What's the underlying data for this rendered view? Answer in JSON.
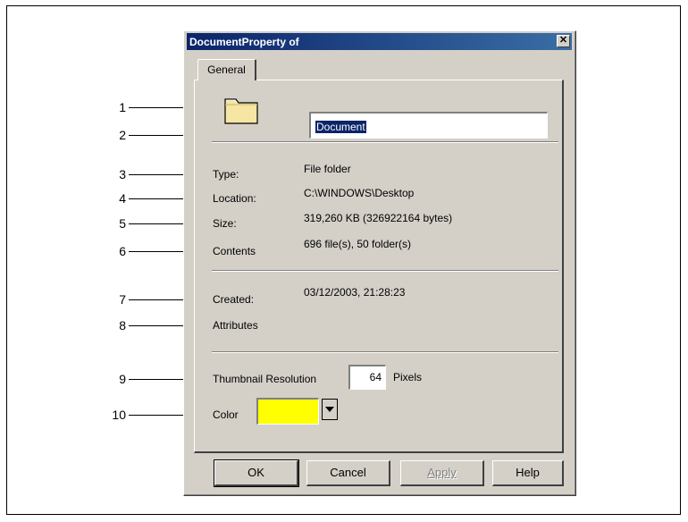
{
  "dialog": {
    "title": "DocumentProperty of",
    "close_symbol": "✕"
  },
  "tabs": [
    {
      "label": "General"
    }
  ],
  "general": {
    "name_value": "Document",
    "type_label": "Type:",
    "type_value": "File folder",
    "location_label": "Location:",
    "location_value": "C:\\WINDOWS\\Desktop",
    "size_label": "Size:",
    "size_value": "319,260 KB (326922164 bytes)",
    "contents_label": "Contents",
    "contents_value": "696 file(s), 50 folder(s)",
    "created_label": "Created:",
    "created_value": "03/12/2003, 21:28:23",
    "attributes_label": "Attributes",
    "thumbnail_label": "Thumbnail Resolution",
    "thumbnail_value": "64",
    "thumbnail_unit": "Pixels",
    "color_label": "Color",
    "color_value": "#ffff00"
  },
  "buttons": {
    "ok": "OK",
    "cancel": "Cancel",
    "apply": "Apply",
    "help": "Help"
  },
  "callouts": [
    "1",
    "2",
    "3",
    "4",
    "5",
    "6",
    "7",
    "8",
    "9",
    "10"
  ],
  "icons": [
    "folder-icon",
    "close-icon",
    "dropdown-arrow-icon"
  ]
}
